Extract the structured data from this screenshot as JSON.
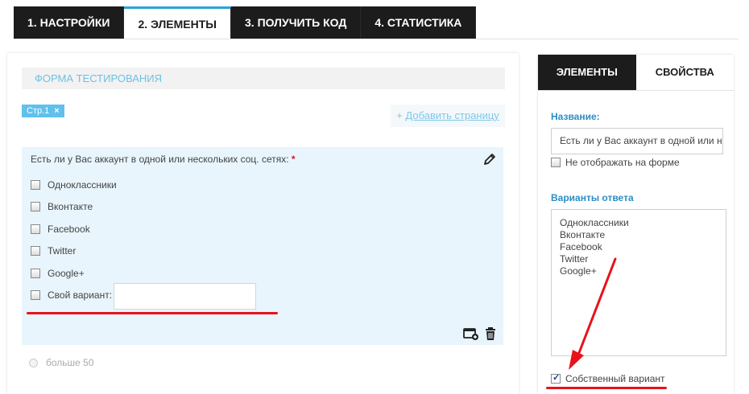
{
  "top_tabs": [
    {
      "label": "1. НАСТРОЙКИ"
    },
    {
      "label": "2. ЭЛЕМЕНТЫ"
    },
    {
      "label": "3. ПОЛУЧИТЬ КОД"
    },
    {
      "label": "4. СТАТИСТИКА"
    }
  ],
  "form": {
    "title": "ФОРМА ТЕСТИРОВАНИЯ",
    "page_chip": "Стр.1",
    "page_chip_close": "×",
    "add_page_plus": "+",
    "add_page_label": "Добавить страницу"
  },
  "question": {
    "label": "Есть ли у Вас аккаунт в одной или нескольких соц. сетях:",
    "required_mark": "*",
    "options": [
      "Одноклассники",
      "Вконтакте",
      "Facebook",
      "Twitter",
      "Google+"
    ],
    "own_variant_label": "Свой вариант:"
  },
  "next_item": {
    "label": "больше 50"
  },
  "right_panel": {
    "tabs": [
      {
        "label": "ЭЛЕМЕНТЫ"
      },
      {
        "label": "СВОЙСТВА"
      }
    ],
    "name_label": "Название:",
    "name_value": "Есть ли у Вас аккаунт в одной или нескольких соц. сетях:",
    "hide_on_form_label": "Не отображать на форме",
    "variants_label": "Варианты ответа",
    "variants": [
      "Одноклассники",
      "Вконтакте",
      "Facebook",
      "Twitter",
      "Google+"
    ],
    "own_variant_label": "Собственный вариант"
  },
  "colors": {
    "accent": "#2aa3d9",
    "dark": "#1c1c1c",
    "highlight_red": "#e8121b",
    "card_bg": "#e8f5fc"
  }
}
